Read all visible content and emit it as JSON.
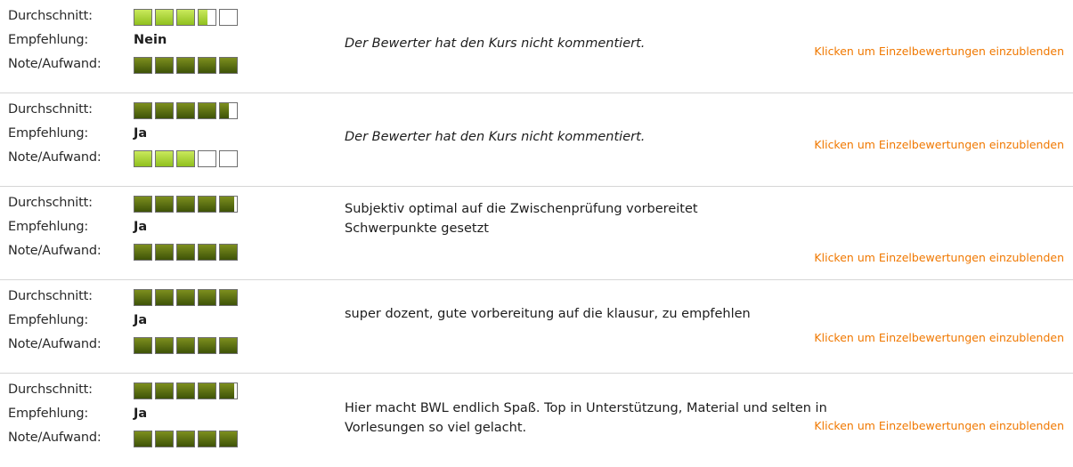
{
  "labels": {
    "average": "Durchschnitt:",
    "recommendation": "Empfehlung:",
    "grade_effort": "Note/Aufwand:"
  },
  "toggle_link": "Klicken um Einzelbewertungen einzublenden",
  "reviews": [
    {
      "recommendation": "Nein",
      "average_rating": 3.5,
      "average_color": "#90c01e",
      "grade_effort_rating": 5,
      "grade_effort_color": "#3e5308",
      "comment": "Der Bewerter hat den Kurs nicht kommentiert.",
      "comment_italic": true
    },
    {
      "recommendation": "Ja",
      "average_rating": 4.5,
      "average_color": "#3e5308",
      "grade_effort_rating": 3,
      "grade_effort_color": "#90c01e",
      "comment": "Der Bewerter hat den Kurs nicht kommentiert.",
      "comment_italic": true
    },
    {
      "recommendation": "Ja",
      "average_rating": 4.85,
      "average_color": "#3e5308",
      "grade_effort_rating": 5,
      "grade_effort_color": "#3e5308",
      "comment": "Subjektiv optimal auf die Zwischenprüfung vorbereitet\nSchwerpunkte gesetzt",
      "comment_italic": false
    },
    {
      "recommendation": "Ja",
      "average_rating": 5,
      "average_color": "#3e5308",
      "grade_effort_rating": 5,
      "grade_effort_color": "#3e5308",
      "comment": "super dozent, gute vorbereitung auf die klausur, zu empfehlen",
      "comment_italic": false
    },
    {
      "recommendation": "Ja",
      "average_rating": 4.85,
      "average_color": "#3e5308",
      "grade_effort_rating": 5,
      "grade_effort_color": "#3e5308",
      "comment": "Hier macht BWL endlich Spaß. Top in Unterstützung, Material und selten in Vorlesungen so viel gelacht.",
      "comment_italic": false
    }
  ]
}
